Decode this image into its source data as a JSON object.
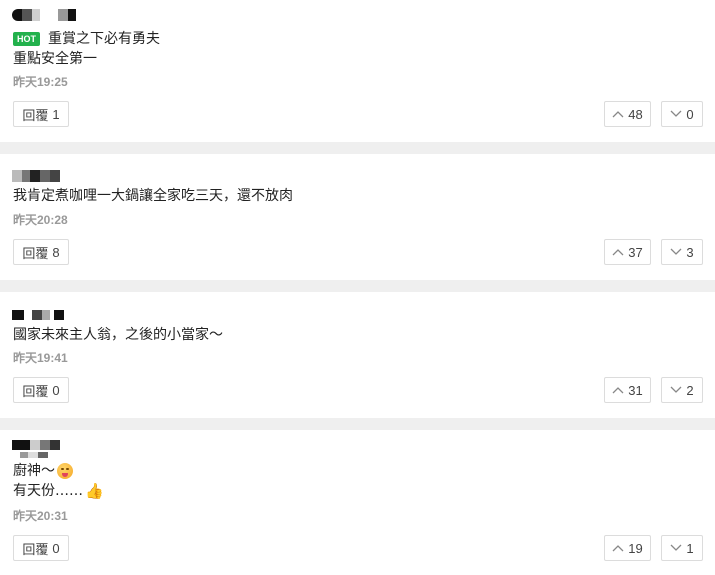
{
  "comments": [
    {
      "hot_badge": "HOT",
      "lines": [
        "重賞之下必有勇夫",
        "重點安全第一"
      ],
      "time": "昨天19:25",
      "reply_label": "回覆",
      "reply_count": "1",
      "up_count": "48",
      "down_count": "0"
    },
    {
      "lines": [
        "我肯定煮咖哩一大鍋讓全家吃三天，還不放肉"
      ],
      "time": "昨天20:28",
      "reply_label": "回覆",
      "reply_count": "8",
      "up_count": "37",
      "down_count": "3"
    },
    {
      "lines": [
        "國家未來主人翁，之後的小當家～"
      ],
      "time": "昨天19:41",
      "reply_label": "回覆",
      "reply_count": "0",
      "up_count": "31",
      "down_count": "2"
    },
    {
      "lines": [
        "廚神～",
        "有天份……"
      ],
      "time": "昨天20:31",
      "reply_label": "回覆",
      "reply_count": "0",
      "up_count": "19",
      "down_count": "1"
    }
  ],
  "icons": {
    "up": "chevron-up-icon",
    "down": "chevron-down-icon",
    "emoji_yum": "yum-face-emoji-icon",
    "emoji_thumb": "thumbs-up-emoji-icon"
  },
  "colors": {
    "hot_badge_bg": "#22b14c",
    "separator": "#efefef",
    "timestamp": "#999999",
    "button_border": "#dcdcdc"
  }
}
